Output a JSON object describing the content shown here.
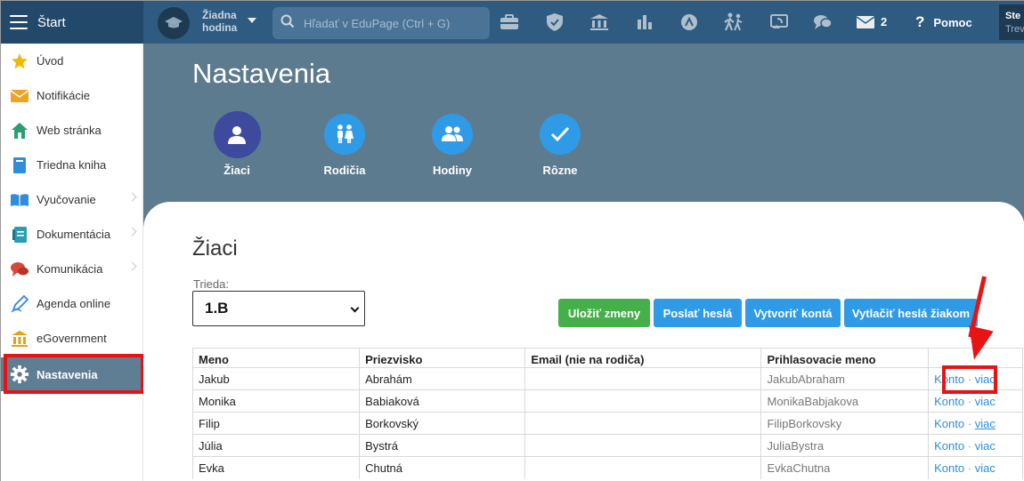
{
  "topbar": {
    "start_label": "Štart",
    "hour_line1": "Žiadna",
    "hour_line2": "hodina",
    "search_placeholder": "Hľadať v EduPage (Ctrl + G)",
    "messages_count": "2",
    "help_label": "Pomoc",
    "user_line1": "Ste",
    "user_line2": "Trev",
    "icons": [
      "briefcase-icon",
      "shield-icon",
      "bank-icon",
      "bar-chart-icon",
      "gauge-icon",
      "people-walking-icon",
      "cast-icon",
      "chat-icon",
      "envelope-icon",
      "help-icon"
    ]
  },
  "sidebar": {
    "items": [
      {
        "label": "Úvod",
        "icon": "star-icon"
      },
      {
        "label": "Notifikácie",
        "icon": "envelope-icon"
      },
      {
        "label": "Web stránka",
        "icon": "house-icon"
      },
      {
        "label": "Triedna kniha",
        "icon": "book-icon"
      },
      {
        "label": "Vyučovanie",
        "icon": "open-book-icon"
      },
      {
        "label": "Dokumentácia",
        "icon": "document-icon"
      },
      {
        "label": "Komunikácia",
        "icon": "chat-bubbles-icon"
      },
      {
        "label": "Agenda online",
        "icon": "pen-icon"
      },
      {
        "label": "eGovernment",
        "icon": "bank-icon"
      },
      {
        "label": "Nastavenia",
        "icon": "gear-icon"
      }
    ]
  },
  "main": {
    "title": "Nastavenia",
    "categories": [
      {
        "label": "Žiaci",
        "icon": "person-icon"
      },
      {
        "label": "Rodičia",
        "icon": "parents-icon"
      },
      {
        "label": "Hodiny",
        "icon": "group-icon"
      },
      {
        "label": "Rôzne",
        "icon": "check-icon"
      }
    ],
    "section_title": "Žiaci",
    "trieda_label": "Trieda:",
    "trieda_value": "1.B",
    "buttons": {
      "save": "Uložiť zmeny",
      "send_passwords": "Poslať heslá",
      "create_accounts": "Vytvoriť kontá",
      "print_passwords": "Vytlačiť heslá žiakom"
    },
    "colors": {
      "save": "#45b049",
      "blue": "#2f9be7",
      "highlight": "#e81313"
    }
  },
  "table": {
    "headers": [
      "Meno",
      "Priezvisko",
      "Email (nie na rodiča)",
      "Prihlasovacie meno",
      ""
    ],
    "rows": [
      {
        "meno": "Jakub",
        "priezvisko": "Abrahám",
        "email": "",
        "login": "JakubAbraham",
        "konto": "Konto",
        "viac": "viac"
      },
      {
        "meno": "Monika",
        "priezvisko": "Babiaková",
        "email": "",
        "login": "MonikaBabjakova",
        "konto": "Konto",
        "viac": "viac"
      },
      {
        "meno": "Filip",
        "priezvisko": "Borkovský",
        "email": "",
        "login": "FilipBorkovsky",
        "konto": "Konto",
        "viac": "viac"
      },
      {
        "meno": "Júlia",
        "priezvisko": "Bystrá",
        "email": "",
        "login": "JuliaBystra",
        "konto": "Konto",
        "viac": "viac"
      },
      {
        "meno": "Evka",
        "priezvisko": "Chutná",
        "email": "",
        "login": "EvkaChutna",
        "konto": "Konto",
        "viac": "viac"
      }
    ],
    "separator": "·"
  }
}
